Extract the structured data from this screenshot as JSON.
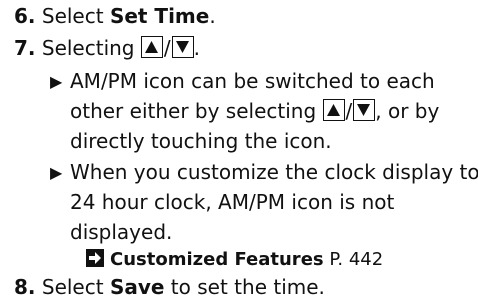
{
  "steps": {
    "s6": {
      "number": "6.",
      "pre": "Select ",
      "bold": "Set Time",
      "post": "."
    },
    "s7": {
      "number": "7.",
      "pre": "Selecting ",
      "slash": "/",
      "post": "."
    },
    "s8": {
      "number": "8.",
      "pre": "Select ",
      "bold": "Save",
      "post": " to set the time."
    }
  },
  "notes": {
    "n1": {
      "l1": "AM/PM icon can be switched to each",
      "l2a": "other either by selecting ",
      "slash": "/",
      "l2b": ", or by",
      "l3": "directly touching the icon."
    },
    "n2": {
      "l1": "When you customize the clock display to",
      "l2": "24 hour clock, AM/PM icon is not",
      "l3": "displayed."
    }
  },
  "reference": {
    "title": "Customized Features",
    "page": " P. 442"
  },
  "icons": {
    "up": "up-triangle-icon",
    "down": "down-triangle-icon",
    "bullet": "right-triangle-bullet-icon",
    "ref": "reference-arrow-icon"
  }
}
